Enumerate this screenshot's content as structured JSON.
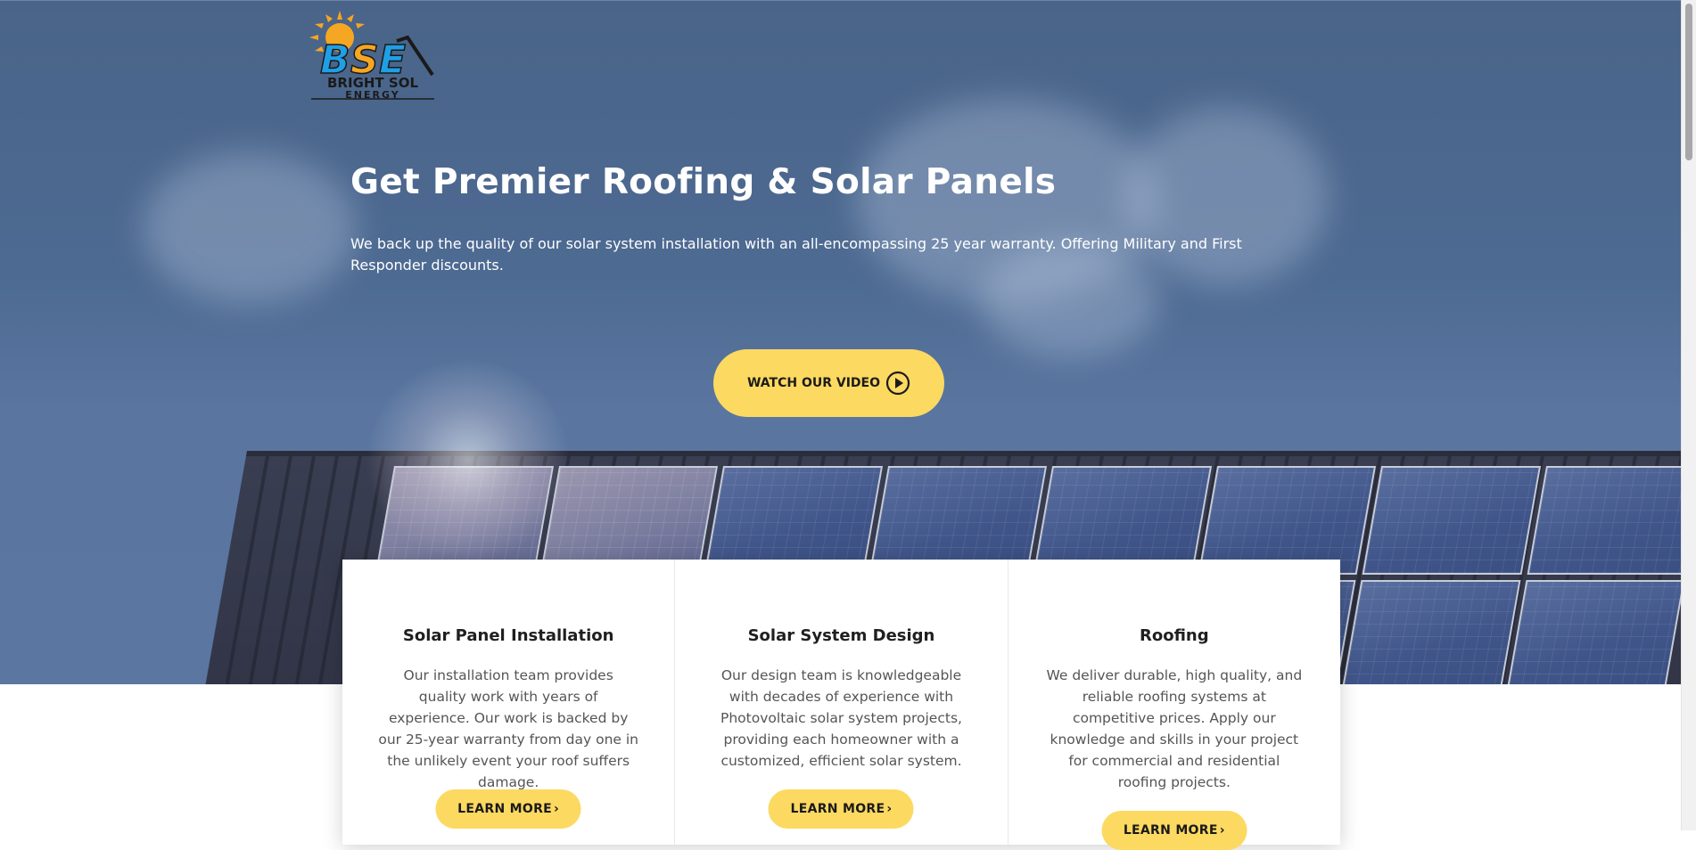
{
  "brand": {
    "name_line1": "BRIGHT SOL",
    "name_line2": "ENERGY",
    "monogram": "BSE",
    "colors": {
      "sun": "#f5a623",
      "blue": "#1ea0e6",
      "dark": "#1a1a1a"
    }
  },
  "hero": {
    "title": "Get Premier Roofing & Solar Panels",
    "subtitle": "We back up the quality of our solar system installation with an all-encompassing 25 year warranty. Offering Military and First Responder discounts.",
    "video_button_label": "WATCH OUR VIDEO",
    "video_button_icon": "play-circle-icon"
  },
  "services": [
    {
      "title": "Solar Panel Installation",
      "text": "Our installation team provides quality work with years of experience. Our work is backed by our 25-year warranty from day one in the unlikely event your roof suffers damage.",
      "button_label": "LEARN MORE",
      "button_icon": "chevron-right-icon"
    },
    {
      "title": "Solar System Design",
      "text": "Our design team is knowledgeable with decades of experience with Photovoltaic solar system projects, providing each homeowner with a customized, efficient solar system.",
      "button_label": "LEARN MORE",
      "button_icon": "chevron-right-icon"
    },
    {
      "title": "Roofing",
      "text": "We deliver durable, high quality, and reliable roofing systems at competitive prices. Apply our knowledge and skills in your project for commercial and residential roofing projects.",
      "button_label": "LEARN MORE",
      "button_icon": "chevron-right-icon"
    }
  ],
  "theme": {
    "accent_yellow": "#fcd961",
    "hero_overlay": "#4d6a92",
    "text_dark": "#1f1f1f",
    "text_body": "#555555"
  }
}
